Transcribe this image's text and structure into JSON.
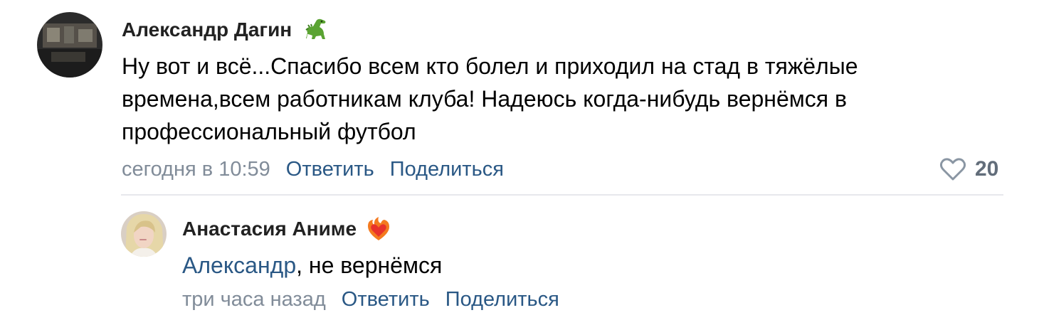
{
  "comments": [
    {
      "author": "Александр Дагин",
      "badge_icon": "dinosaur-icon",
      "text": "Ну вот и всё...Спасибо всем кто болел и приходил на стад в тяжёлые времена,всем работникам клуба! Надеюсь когда-нибудь вернёмся в профессиональный футбол",
      "time": "сегодня в 10:59",
      "reply_label": "Ответить",
      "share_label": "Поделиться",
      "likes": "20"
    }
  ],
  "replies": [
    {
      "author": "Анастасия Аниме",
      "badge_icon": "fire-heart-icon",
      "mention": "Александр",
      "text": ", не вернёмся",
      "time": "три часа назад",
      "reply_label": "Ответить",
      "share_label": "Поделиться"
    }
  ],
  "colors": {
    "link": "#2a5885",
    "meta": "#818c99",
    "divider": "#e7e8ec"
  }
}
